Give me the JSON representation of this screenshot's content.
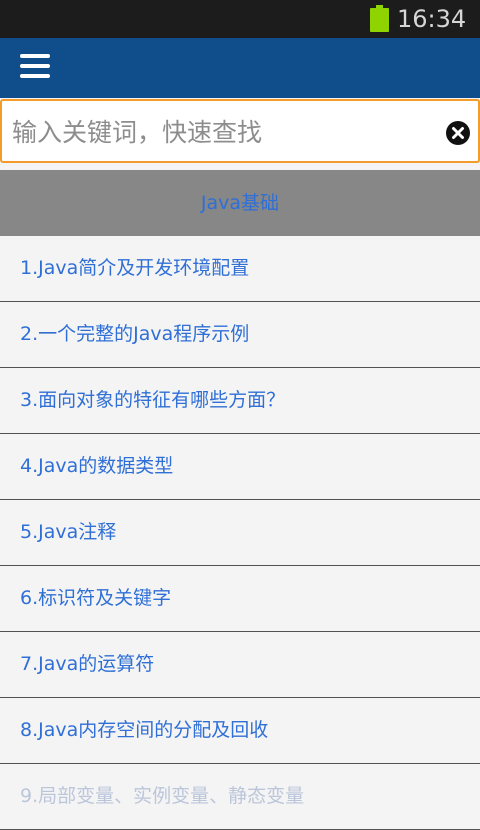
{
  "status_bar": {
    "time": "16:34",
    "battery_color": "#8fd300"
  },
  "app_bar": {
    "background": "#0f4d8b",
    "menu_icon": "hamburger-menu-icon"
  },
  "search": {
    "placeholder": "输入关键词，快速查找",
    "value": "",
    "clear_icon": "clear-icon",
    "border_color": "#f39c2b"
  },
  "section": {
    "title": "Java基础"
  },
  "list": {
    "items": [
      "1.Java简介及开发环境配置",
      "2.一个完整的Java程序示例",
      "3.面向对象的特征有哪些方面？",
      "4.Java的数据类型",
      "5.Java注释",
      "6.标识符及关键字",
      "7.Java的运算符",
      "8.Java内存空间的分配及回收",
      "9.局部变量、实例变量、静态变量"
    ]
  }
}
